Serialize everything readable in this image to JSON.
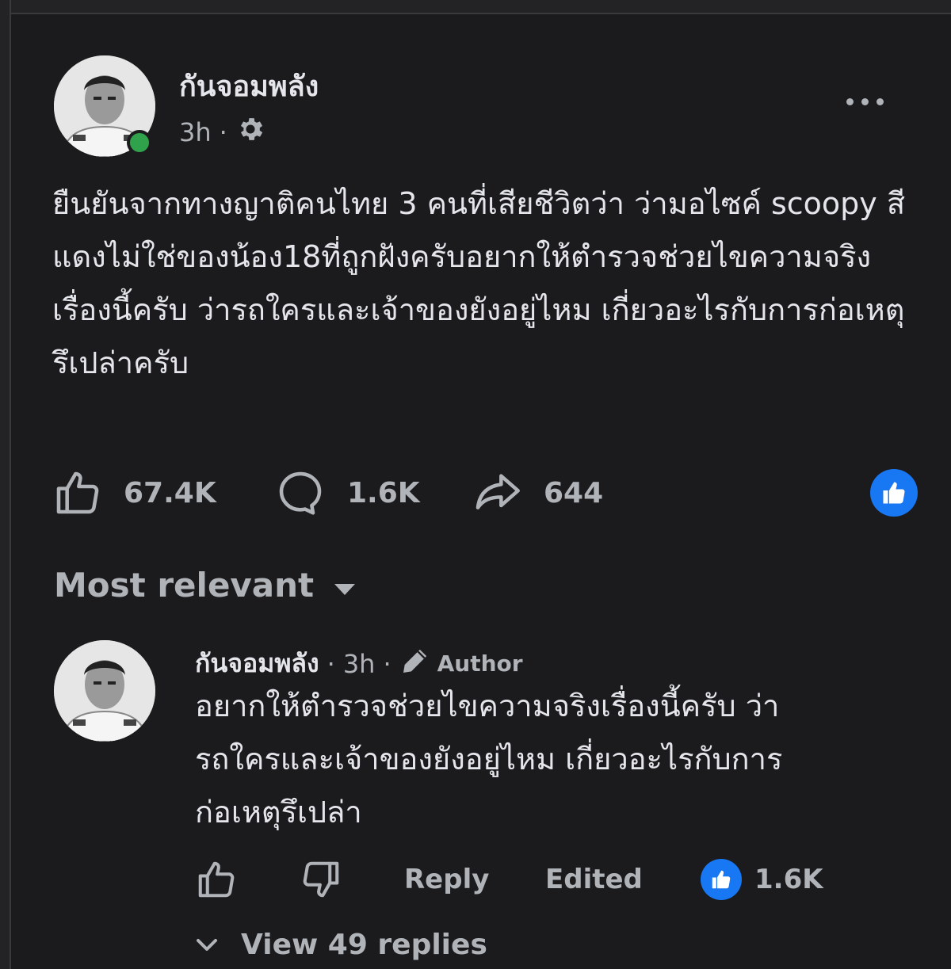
{
  "post": {
    "author_name": "กันจอมพลัง",
    "time": "3h",
    "separator": "·",
    "privacy_icon": "gear-icon",
    "more_icon": "more-horizontal-icon",
    "text": "ยืนยันจากทางญาติคนไทย 3 คนที่เสียชีวิตว่า ว่ามอไซค์ scoopy สีแดงไม่ใช่ของน้อง18ที่ถูกฝังครับอยากให้ตำรวจช่วยไขความจริงเรื่องนี้ครับ ว่ารถใครและเจ้าของยังอยู่ไหม เกี่ยวอะไรกับการก่อเหตุรึเปล่าครับ",
    "stats": {
      "likes": "67.4K",
      "comments": "1.6K",
      "shares": "644"
    },
    "reaction_icon": "like-reaction-icon"
  },
  "comments_sort": {
    "label": "Most relevant",
    "icon": "caret-down-icon"
  },
  "comment": {
    "author_name": "กันจอมพลัง",
    "separator": "·",
    "time": "3h",
    "badge_icon": "pencil-icon",
    "badge_label": "Author",
    "text": "อยากให้ตำรวจช่วยไขความจริงเรื่องนี้ครับ ว่ารถใครและเจ้าของยังอยู่ไหม เกี่ยวอะไรกับการก่อเหตุรึเปล่า",
    "reply_label": "Reply",
    "edited_label": "Edited",
    "reaction_count": "1.6K",
    "view_replies_label": "View 49 replies"
  },
  "colors": {
    "background": "#1b1b1d",
    "primary_text": "#e4e6eb",
    "secondary_text": "#b0b3b8",
    "accent_blue": "#1877f2",
    "online_green": "#31a24c"
  }
}
